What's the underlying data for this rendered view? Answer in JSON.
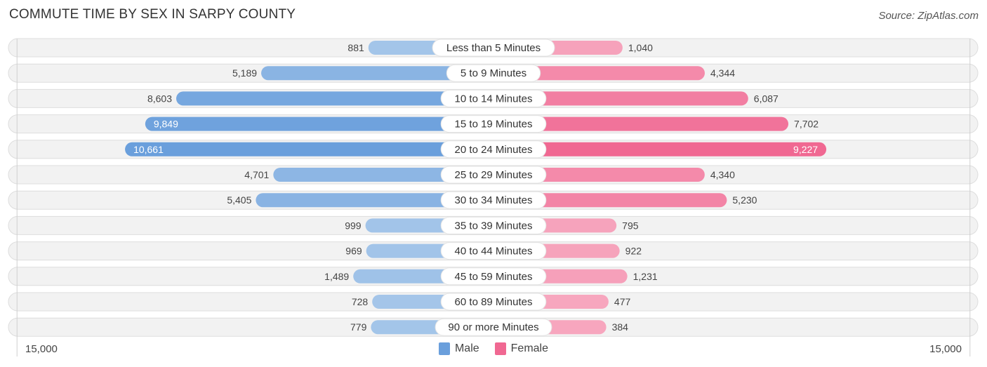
{
  "title": "COMMUTE TIME BY SEX IN SARPY COUNTY",
  "source": "Source: ZipAtlas.com",
  "colors": {
    "male_strong": "#6a9fdc",
    "male_light": "#a8c8ea",
    "female_strong": "#f06892",
    "female_light": "#f7a9c0",
    "track": "#f2f2f2",
    "track_border": "#dddddd",
    "gridline": "#d0d0d0"
  },
  "legend": [
    {
      "label": "Male",
      "color": "#6a9fdc"
    },
    {
      "label": "Female",
      "color": "#f06892"
    }
  ],
  "axis": {
    "left_label": "15,000",
    "right_label": "15,000"
  },
  "chart_data": {
    "type": "bar",
    "orientation": "horizontal-diverging",
    "title": "COMMUTE TIME BY SEX IN SARPY COUNTY",
    "xlabel": "",
    "ylabel": "",
    "xlim": [
      -15000,
      15000
    ],
    "grid": false,
    "legend_position": "bottom-center",
    "categories": [
      "Less than 5 Minutes",
      "5 to 9 Minutes",
      "10 to 14 Minutes",
      "15 to 19 Minutes",
      "20 to 24 Minutes",
      "25 to 29 Minutes",
      "30 to 34 Minutes",
      "35 to 39 Minutes",
      "40 to 44 Minutes",
      "45 to 59 Minutes",
      "60 to 89 Minutes",
      "90 or more Minutes"
    ],
    "series": [
      {
        "name": "Male",
        "side": "left",
        "values": [
          881,
          5189,
          8603,
          9849,
          10661,
          4701,
          5405,
          999,
          969,
          1489,
          728,
          779
        ],
        "labels": [
          "881",
          "5,189",
          "8,603",
          "9,849",
          "10,661",
          "4,701",
          "5,405",
          "999",
          "969",
          "1,489",
          "728",
          "779"
        ]
      },
      {
        "name": "Female",
        "side": "right",
        "values": [
          1040,
          4344,
          6087,
          7702,
          9227,
          4340,
          5230,
          795,
          922,
          1231,
          477,
          384
        ],
        "labels": [
          "1,040",
          "4,344",
          "6,087",
          "7,702",
          "9,227",
          "4,340",
          "5,230",
          "795",
          "922",
          "1,231",
          "477",
          "384"
        ]
      }
    ]
  }
}
